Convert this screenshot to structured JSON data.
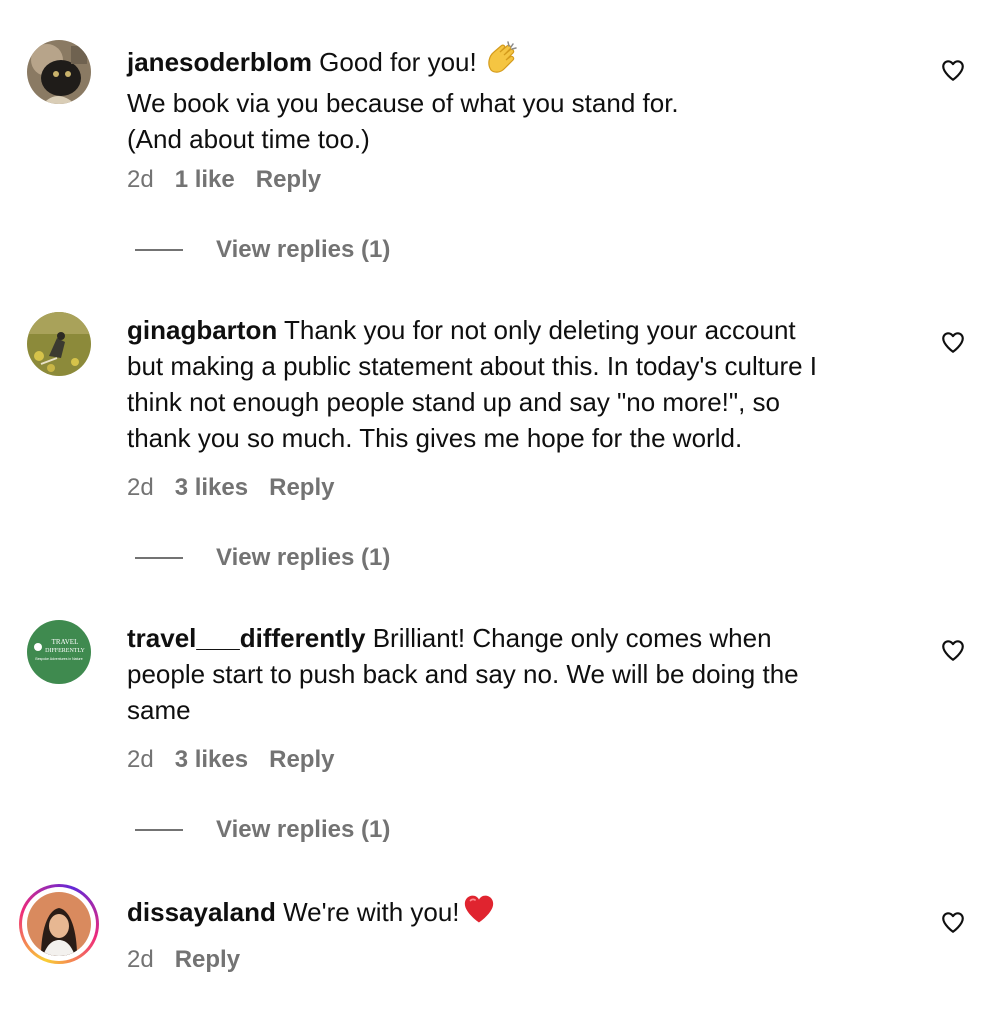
{
  "comments": [
    {
      "username": "janesoderblom",
      "lines": [
        "Good for you!",
        "We book via you because of what you stand for.",
        "(And about time too.)"
      ],
      "emoji": "clapping-hands",
      "time": "2d",
      "likes": "1 like",
      "reply": "Reply",
      "view_replies": "View replies (1)"
    },
    {
      "username": "ginagbarton",
      "lines": [
        "Thank you for not only deleting your account",
        "but making a public statement about this. In today's culture I",
        "think not enough people stand up and say \"no more!\", so",
        "thank you so much. This gives me hope for the world."
      ],
      "time": "2d",
      "likes": "3 likes",
      "reply": "Reply",
      "view_replies": "View replies (1)"
    },
    {
      "username": "travel___differently",
      "lines": [
        "Brilliant! Change only comes when",
        "people start to push back and say no. We will be doing the",
        "same"
      ],
      "time": "2d",
      "likes": "3 likes",
      "reply": "Reply",
      "view_replies": "View replies (1)",
      "avatar_text": [
        "TRAVEL",
        "DIFFERENTLY",
        "Bespoke Adventures in Nature"
      ]
    },
    {
      "username": "dissayaland",
      "lines": [
        "We're with you!"
      ],
      "emoji": "red-heart",
      "time": "2d",
      "reply": "Reply"
    }
  ],
  "colors": {
    "text": "#0f0f0f",
    "secondary": "#737373",
    "travel_green": "#3f8a4f"
  }
}
